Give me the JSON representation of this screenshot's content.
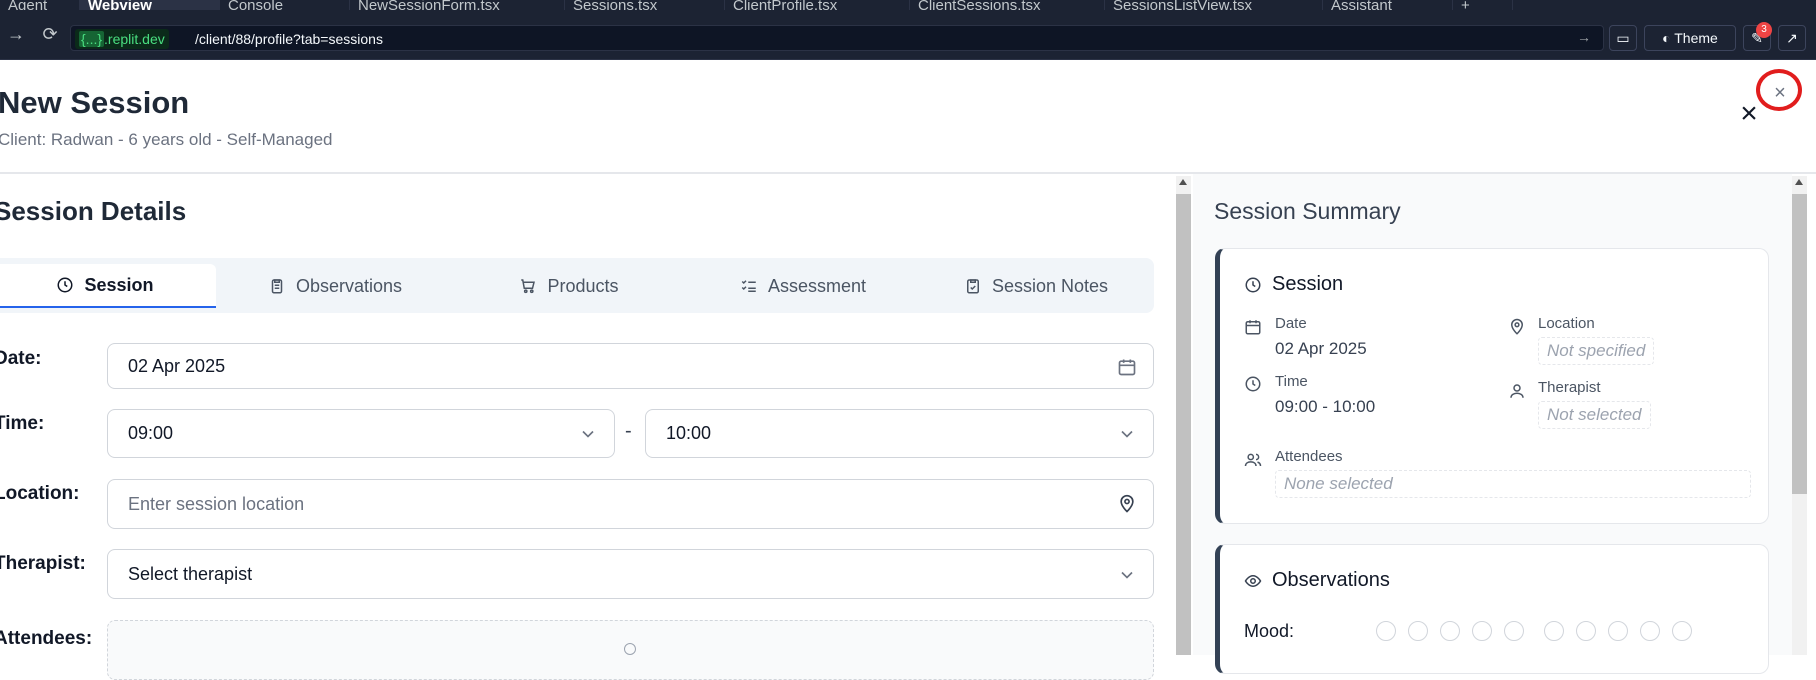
{
  "ide": {
    "tabs": [
      "Agent",
      "Webview",
      "Console",
      "NewSessionForm.tsx",
      "Sessions.tsx",
      "ClientProfile.tsx",
      "ClientSessions.tsx",
      "SessionsListView.tsx",
      "Assistant",
      "+"
    ]
  },
  "browser": {
    "host": "{...}.replit.dev",
    "host_prefix": "{...}",
    "host_suffix": ".replit.dev",
    "path": "/client/88/profile?tab=sessions",
    "theme_label": "Theme",
    "notification_count": "3"
  },
  "dialog": {
    "title": "New Session",
    "subtitle": "Client: Radwan - 6 years old - Self-Managed",
    "close": "×"
  },
  "form": {
    "section_title": "Session Details",
    "tabs": [
      {
        "label": "Session",
        "icon": "clock-icon"
      },
      {
        "label": "Observations",
        "icon": "clipboard-icon"
      },
      {
        "label": "Products",
        "icon": "cart-icon"
      },
      {
        "label": "Assessment",
        "icon": "checklist-icon"
      },
      {
        "label": "Session Notes",
        "icon": "notes-icon"
      }
    ],
    "date_label": "Date:",
    "date_value": "02 Apr 2025",
    "time_label": "Time:",
    "time_start": "09:00",
    "time_end": "10:00",
    "time_separator": "-",
    "location_label": "Location:",
    "location_placeholder": "Enter session location",
    "therapist_label": "Therapist:",
    "therapist_placeholder": "Select therapist",
    "attendees_label": "Attendees:"
  },
  "summary": {
    "title": "Session Summary",
    "session_card": {
      "title": "Session",
      "date_label": "Date",
      "date_value": "02 Apr 2025",
      "time_label": "Time",
      "time_value": "09:00 - 10:00",
      "location_label": "Location",
      "location_value": "Not specified",
      "therapist_label": "Therapist",
      "therapist_value": "Not selected",
      "attendees_label": "Attendees",
      "attendees_value": "None selected"
    },
    "observations_card": {
      "title": "Observations",
      "mood_label": "Mood:"
    }
  }
}
